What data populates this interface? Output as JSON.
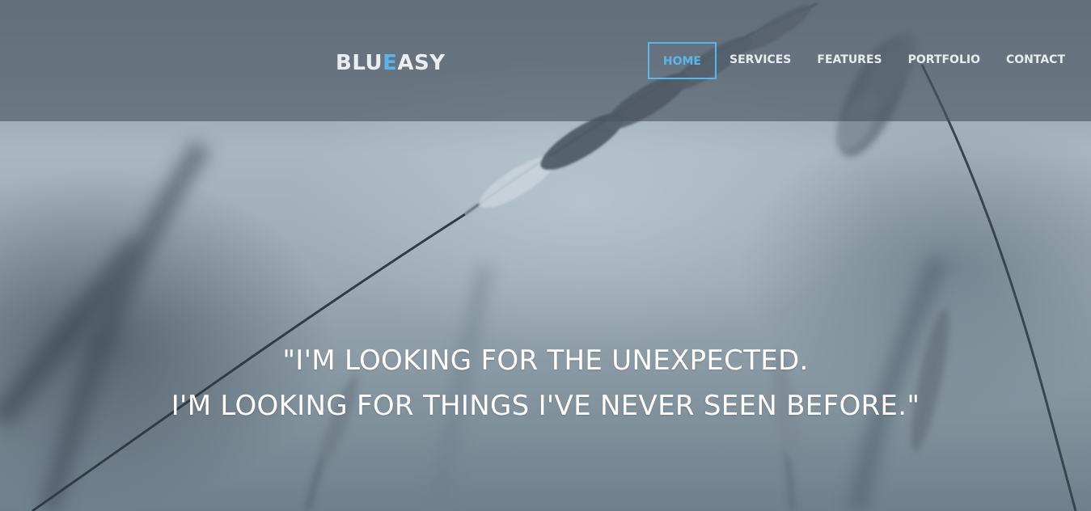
{
  "logo": {
    "part1": "BLU",
    "accent": "E",
    "part2": "ASY"
  },
  "nav": {
    "items": [
      {
        "label": "HOME",
        "active": true
      },
      {
        "label": "SERVICES",
        "active": false
      },
      {
        "label": "FEATURES",
        "active": false
      },
      {
        "label": "PORTFOLIO",
        "active": false
      },
      {
        "label": "CONTACT",
        "active": false
      }
    ]
  },
  "hero": {
    "quote_line1": "\"I'M LOOKING FOR THE UNEXPECTED.",
    "quote_line2": "I'M LOOKING FOR THINGS I'VE NEVER SEEN BEFORE.\""
  },
  "colors": {
    "accent": "#5ab6e8",
    "header_overlay": "#485460",
    "text_light": "#e7ecef"
  }
}
